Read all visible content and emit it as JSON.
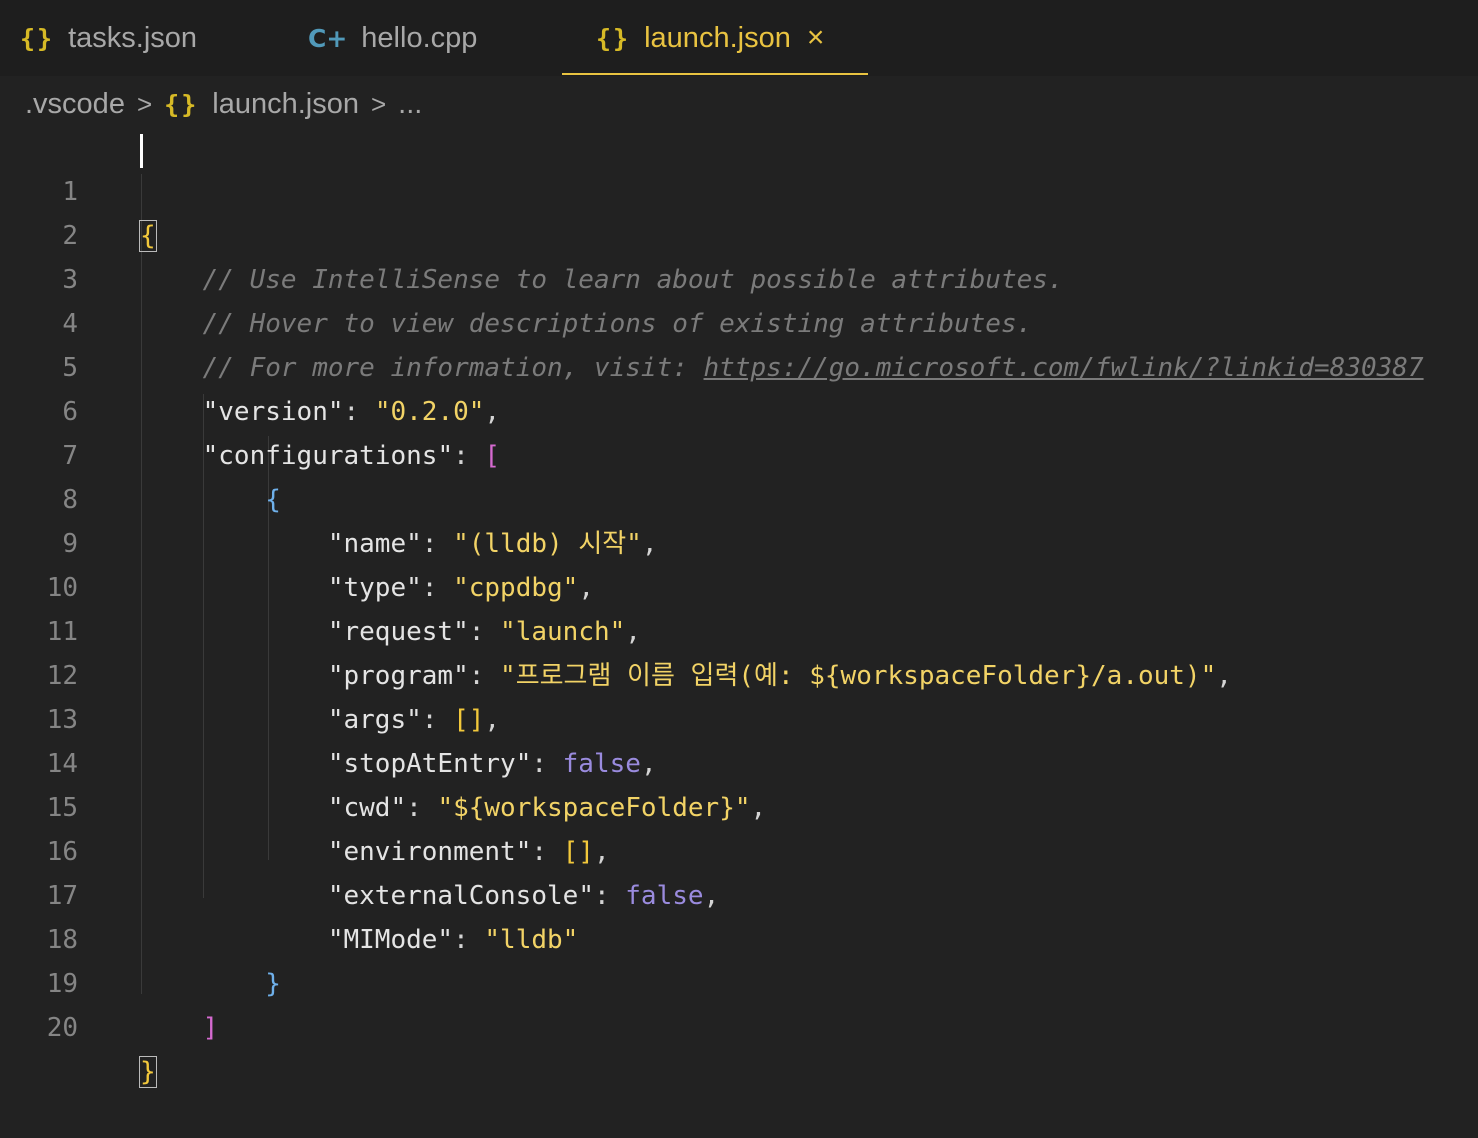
{
  "tabs": [
    {
      "icon": "{}",
      "label": "tasks.json"
    },
    {
      "icon": "C+",
      "label": "hello.cpp"
    },
    {
      "icon": "{}",
      "label": "launch.json",
      "close": "×"
    }
  ],
  "breadcrumb": {
    "folder": ".vscode",
    "sep": ">",
    "icon": "{}",
    "file": "launch.json",
    "more": "..."
  },
  "editor": {
    "line_numbers": [
      "1",
      "2",
      "3",
      "4",
      "5",
      "6",
      "7",
      "8",
      "9",
      "10",
      "11",
      "12",
      "13",
      "14",
      "15",
      "16",
      "17",
      "18",
      "19",
      "20"
    ],
    "comments": {
      "c2": "// Use IntelliSense to learn about possible attributes.",
      "c3": "// Hover to view descriptions of existing attributes.",
      "c4": "// For more information, visit: ",
      "c4_link": "https://go.microsoft.com/fwlink/?linkid=830387"
    },
    "keys": {
      "version": "version",
      "configurations": "configurations",
      "name": "name",
      "type": "type",
      "request": "request",
      "program": "program",
      "args": "args",
      "stopAtEntry": "stopAtEntry",
      "cwd": "cwd",
      "environment": "environment",
      "externalConsole": "externalConsole",
      "MIMode": "MIMode"
    },
    "values": {
      "version": "0.2.0",
      "name": "(lldb) 시작",
      "type": "cppdbg",
      "request": "launch",
      "program": "프로그램 이름 입력(예: ${workspaceFolder}/a.out)",
      "args": "[]",
      "stopAtEntry": "false",
      "cwd": "${workspaceFolder}",
      "environment": "[]",
      "externalConsole": "false",
      "MIMode": "lldb"
    }
  },
  "colors": {
    "accent": "#e9c341",
    "background": "#222222",
    "string": "#f2d366",
    "boolean": "#9a8bde",
    "comment": "#7b7b7b"
  }
}
